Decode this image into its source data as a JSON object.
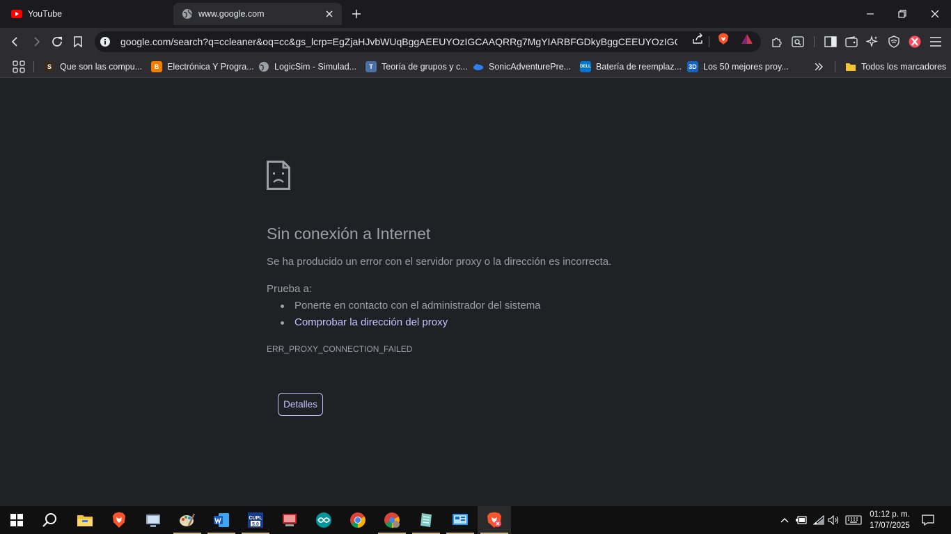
{
  "tabs": [
    {
      "title": "YouTube",
      "active": false
    },
    {
      "title": "www.google.com",
      "active": true
    }
  ],
  "omnibox": {
    "url": "google.com/search?q=ccleaner&oq=cc&gs_lcrp=EgZjaHJvbWUqBggAEEUYOzIGCAAQRRg7MgYIARBFGDkyBggCEEUYOzIGCAM..."
  },
  "bookmarks": [
    {
      "label": "Que son las compu...",
      "icon": "globe-dark-icon"
    },
    {
      "label": "Electrónica Y Progra...",
      "icon": "blogger-icon"
    },
    {
      "label": "LogicSim - Simulad...",
      "icon": "globe-icon"
    },
    {
      "label": "Teoría de grupos y c...",
      "icon": "shield-icon"
    },
    {
      "label": "SonicAdventurePre...",
      "icon": "cloud-icon"
    },
    {
      "label": "Batería de reemplaz...",
      "icon": "dell-icon"
    },
    {
      "label": "Los 50 mejores proy...",
      "icon": "3d-icon"
    }
  ],
  "all_bookmarks": "Todos los marcadores",
  "error": {
    "title": "Sin conexión a Internet",
    "description": "Se ha producido un error con el servidor proxy o la dirección es incorrecta.",
    "try_label": "Prueba a:",
    "suggestions": [
      "Ponerte en contacto con el administrador del sistema",
      "Comprobar la dirección del proxy"
    ],
    "code": "ERR_PROXY_CONNECTION_FAILED",
    "details_button": "Detalles"
  },
  "taskbar": {
    "time": "01:12 p. m.",
    "date": "17/07/2025"
  },
  "colors": {
    "accent_link": "#c5c1ff",
    "page_bg": "#202124",
    "brave_orange": "#fb542b"
  }
}
